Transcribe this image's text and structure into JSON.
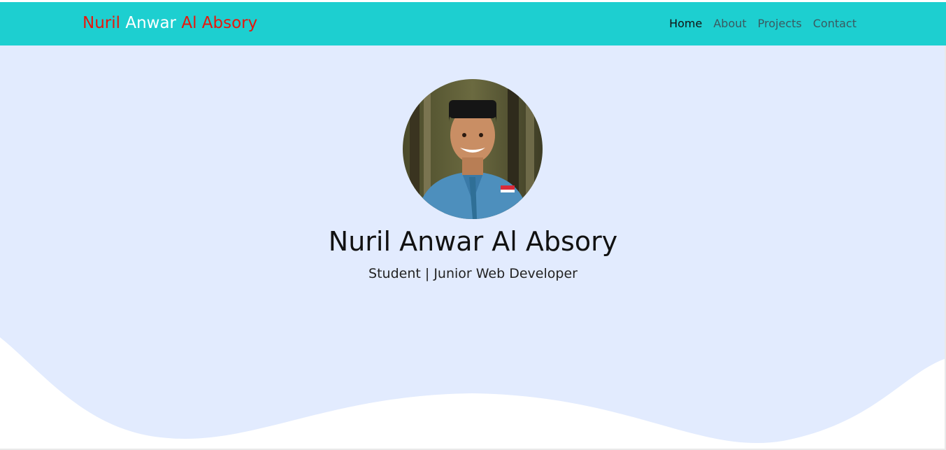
{
  "brand": {
    "part1": "Nuril",
    "part2": "Anwar",
    "part3": "Al Absory"
  },
  "nav": {
    "items": [
      {
        "label": "Home",
        "active": true
      },
      {
        "label": "About",
        "active": false
      },
      {
        "label": "Projects",
        "active": false
      },
      {
        "label": "Contact",
        "active": false
      }
    ]
  },
  "hero": {
    "name": "Nuril Anwar Al Absory",
    "subtitle": "Student | Junior Web Developer",
    "avatar_icon": "profile-photo"
  },
  "colors": {
    "navbar": "#1dcfd0",
    "brand_red": "#e8160c",
    "brand_white": "#ffffff",
    "hero_bg": "#e2ebfe",
    "nav_link": "#3a5a60",
    "nav_active": "#111111"
  }
}
